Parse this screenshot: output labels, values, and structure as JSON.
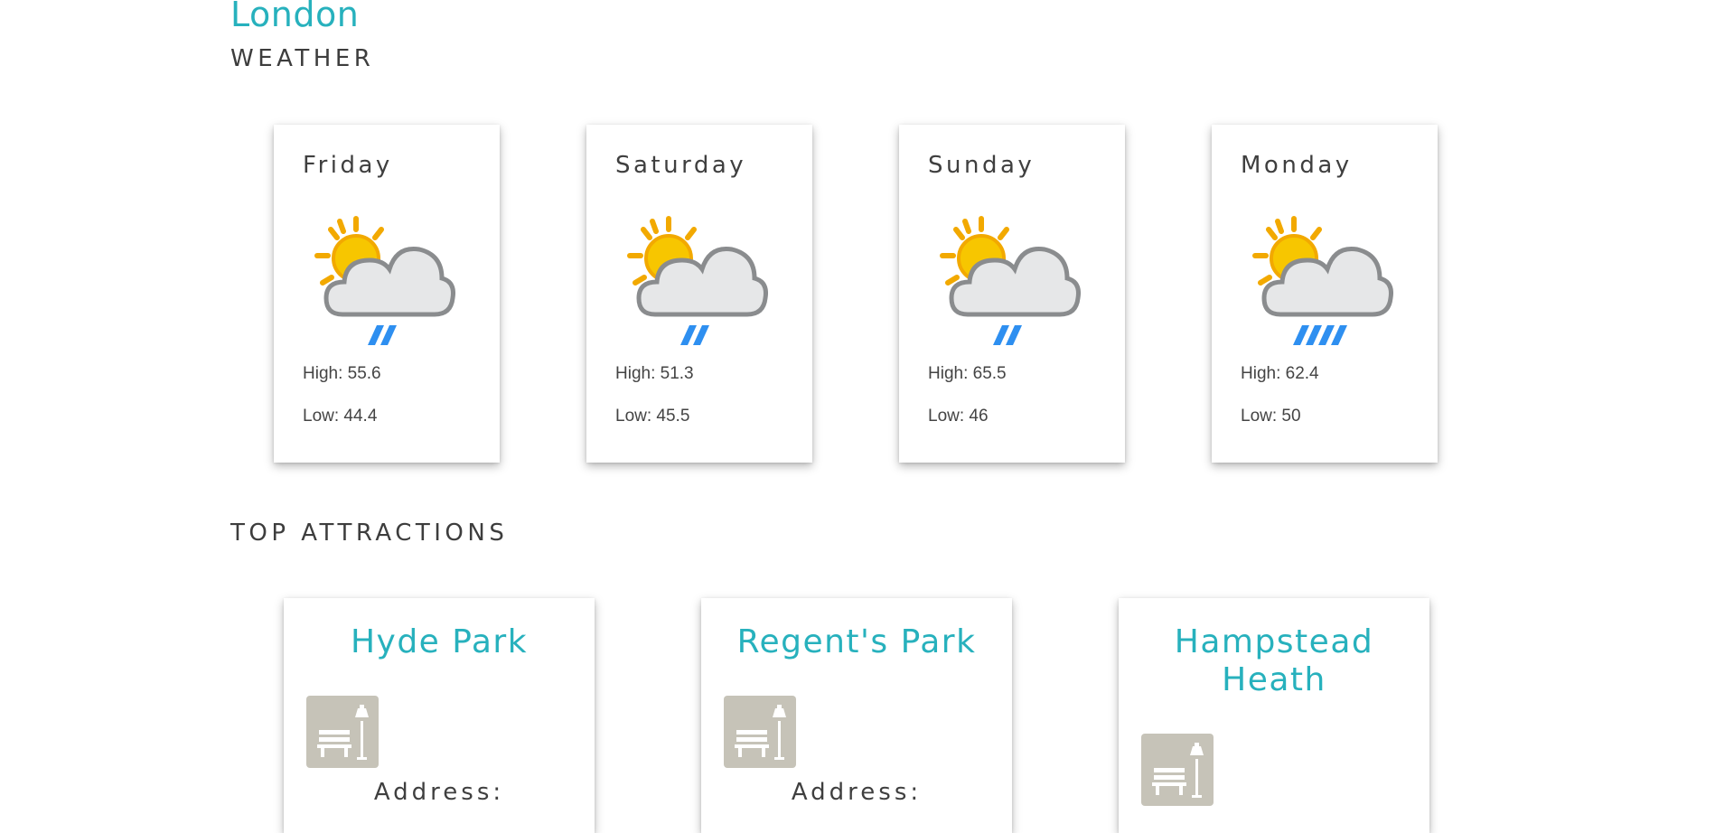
{
  "city": "London",
  "weather": {
    "section_title": "WEATHER",
    "days": [
      {
        "day": "Friday",
        "high": "High: 55.6",
        "low": "Low: 44.4",
        "icon": "partly-cloudy-light-rain-icon"
      },
      {
        "day": "Saturday",
        "high": "High: 51.3",
        "low": "Low: 45.5",
        "icon": "partly-cloudy-light-rain-icon"
      },
      {
        "day": "Sunday",
        "high": "High: 65.5",
        "low": "Low: 46",
        "icon": "partly-cloudy-light-rain-icon"
      },
      {
        "day": "Monday",
        "high": "High: 62.4",
        "low": "Low: 50",
        "icon": "partly-cloudy-rain-icon"
      }
    ]
  },
  "attractions": {
    "section_title": "TOP ATTRACTIONS",
    "items": [
      {
        "name": "Hyde Park",
        "address_label": "Address:",
        "icon": "park-bench-icon"
      },
      {
        "name": "Regent's Park",
        "address_label": "Address:",
        "icon": "park-bench-icon"
      },
      {
        "name": "Hampstead Heath",
        "address_label": "",
        "icon": "park-bench-icon"
      }
    ]
  },
  "colors": {
    "accent": "#27b1bd",
    "text": "#3f3f3f",
    "icon_bg": "#c6c3b8"
  }
}
